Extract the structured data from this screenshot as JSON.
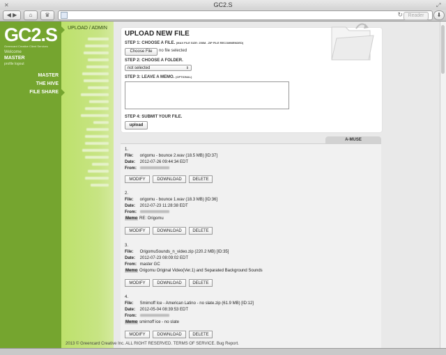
{
  "window": {
    "title": "GC2.S"
  },
  "browser": {
    "reader_label": "Reader"
  },
  "sidebar": {
    "logo": "GC2.S",
    "logo_subtitle": "Greencard Creative Client Services",
    "welcome": "Welcome",
    "username": "MASTER",
    "profile_links": "profile logout",
    "nav": [
      {
        "label": "MASTER"
      },
      {
        "label": "THE HIVE"
      },
      {
        "label": "FILE SHARE"
      }
    ],
    "upload_admin": "UPLOAD / ADMIN"
  },
  "upload": {
    "title": "UPLOAD NEW FILE",
    "step1": "STEP 1: CHOOSE A FILE.",
    "step1_note": "(MAX FILE SIZE: 256M. .ZIP FILE RECOMMENDED)",
    "choose_file": "Choose File",
    "no_file": "no file selected",
    "step2": "STEP 2: CHOOSE A FOLDER.",
    "folder_selected": "not selected",
    "step3": "STEP 3: LEAVE A MEMO.",
    "step3_note": "(OPTIONAL)",
    "step4": "STEP 4: SUBMIT YOUR FILE.",
    "upload_button": "upload"
  },
  "tab": {
    "label": "A-MUSE"
  },
  "labels": {
    "file": "File:",
    "date": "Date:",
    "from": "From:",
    "memo": "Memo"
  },
  "actions": {
    "modify": "MODIFY",
    "download": "DOWNLOAD",
    "delete": "DELETE"
  },
  "entries": [
    {
      "num": "1.",
      "file": "origomu - bounce 2.wav (18.5 MB) [ID:37]",
      "date": "2012-07-26 09:44:34 EDT",
      "from": "",
      "memo": ""
    },
    {
      "num": "2.",
      "file": "origomu - bounce 1.wav (18.3 MB) [ID:36]",
      "date": "2012-07-23 11:28:38 EDT",
      "from": "",
      "memo": "RE: Origomu"
    },
    {
      "num": "3.",
      "file": "OrigomuSounds_n_video.zip (220.2 MB) [ID:35]",
      "date": "2012-07-23 08:09:02 EDT",
      "from": "master GC",
      "memo": "Origomu Original Video(Ver.1) and Separated Background Sounds"
    },
    {
      "num": "4.",
      "file": "Smirnoff Ice - American Latino - no slate.zip (61.9 MB) [ID:12]",
      "date": "2012-05-04 08:39:53 EDT",
      "from": "",
      "memo": "smirnoff ice - no slate"
    }
  ],
  "footer": "2013 © Greencard Creative Inc. ALL RIGHT RESERVED. TERMS OF SERVICE. Bug Report."
}
